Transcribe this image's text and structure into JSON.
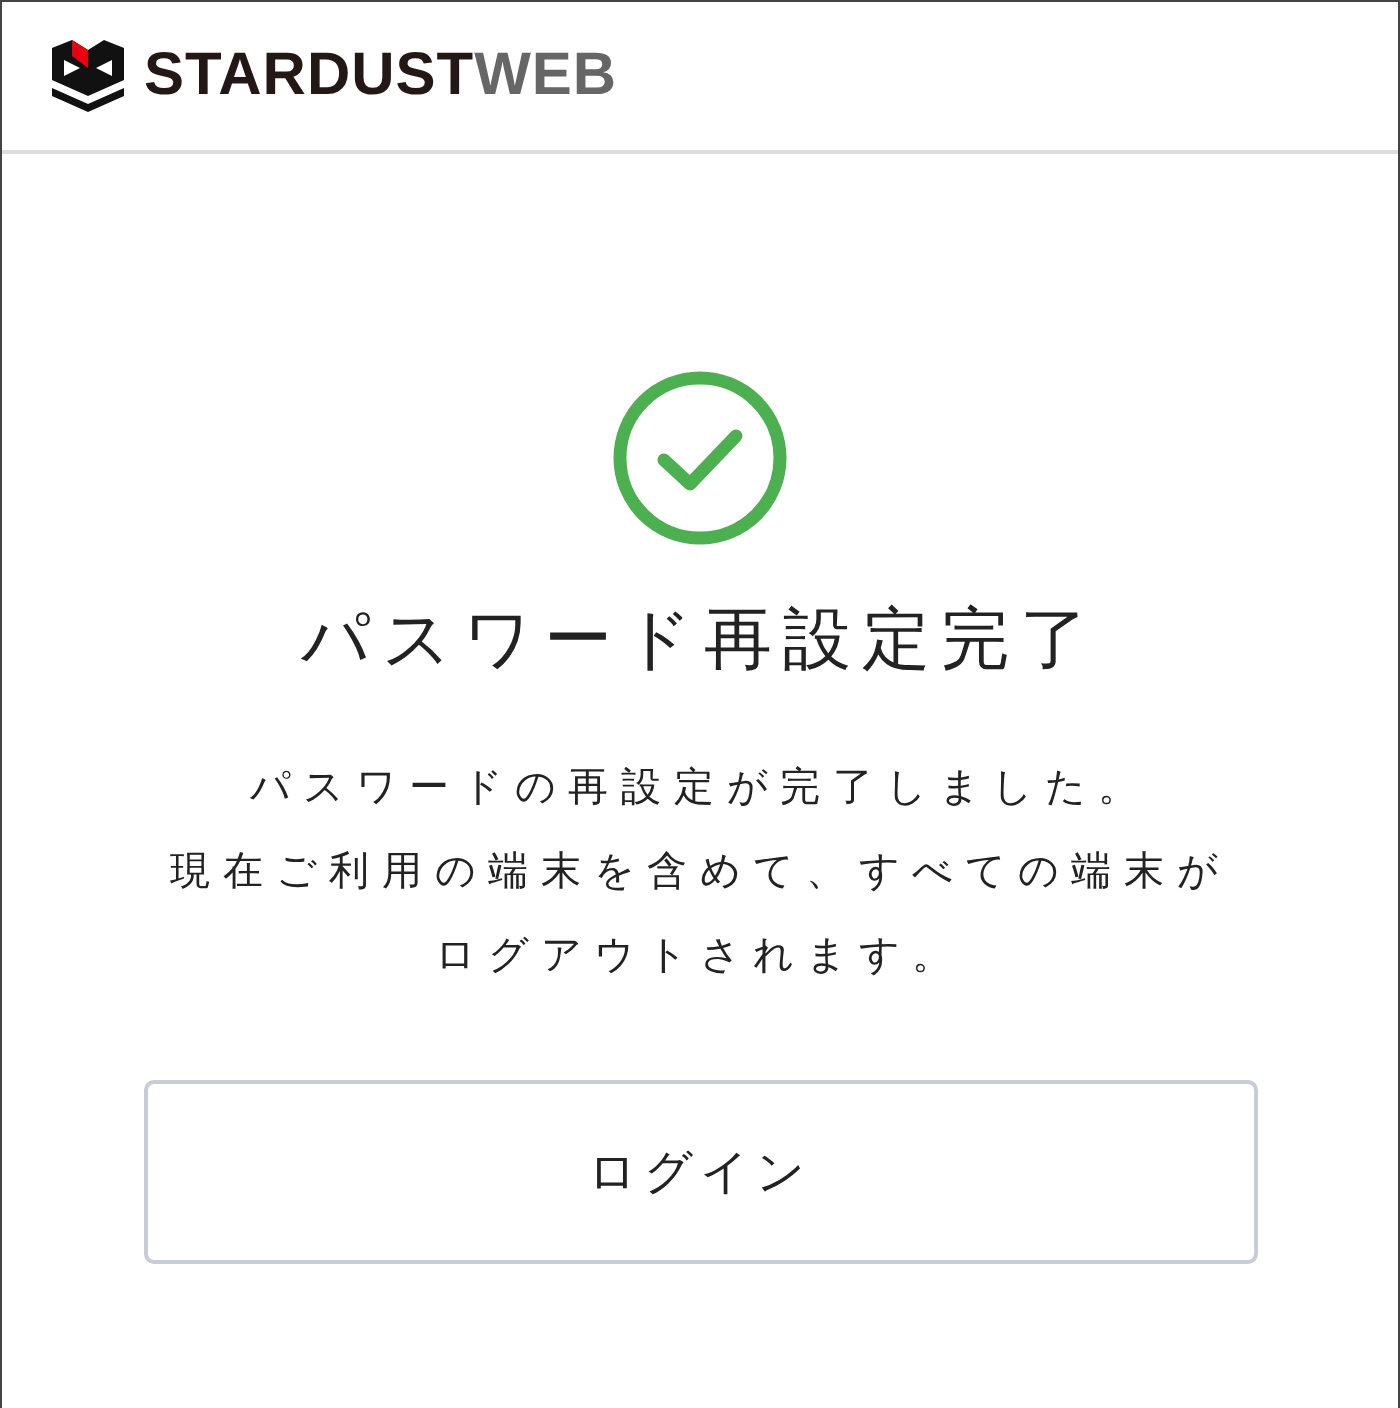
{
  "header": {
    "logo": {
      "primary": "STARDUST",
      "secondary": "WEB"
    }
  },
  "status": {
    "kind": "success",
    "title": "パスワード再設定完了",
    "messages": [
      "パスワードの再設定が完了しました。",
      "現在ご利用の端末を含めて、すべての端末がログアウトされます。"
    ]
  },
  "buttons": [
    {
      "label": "ログイン"
    }
  ]
}
